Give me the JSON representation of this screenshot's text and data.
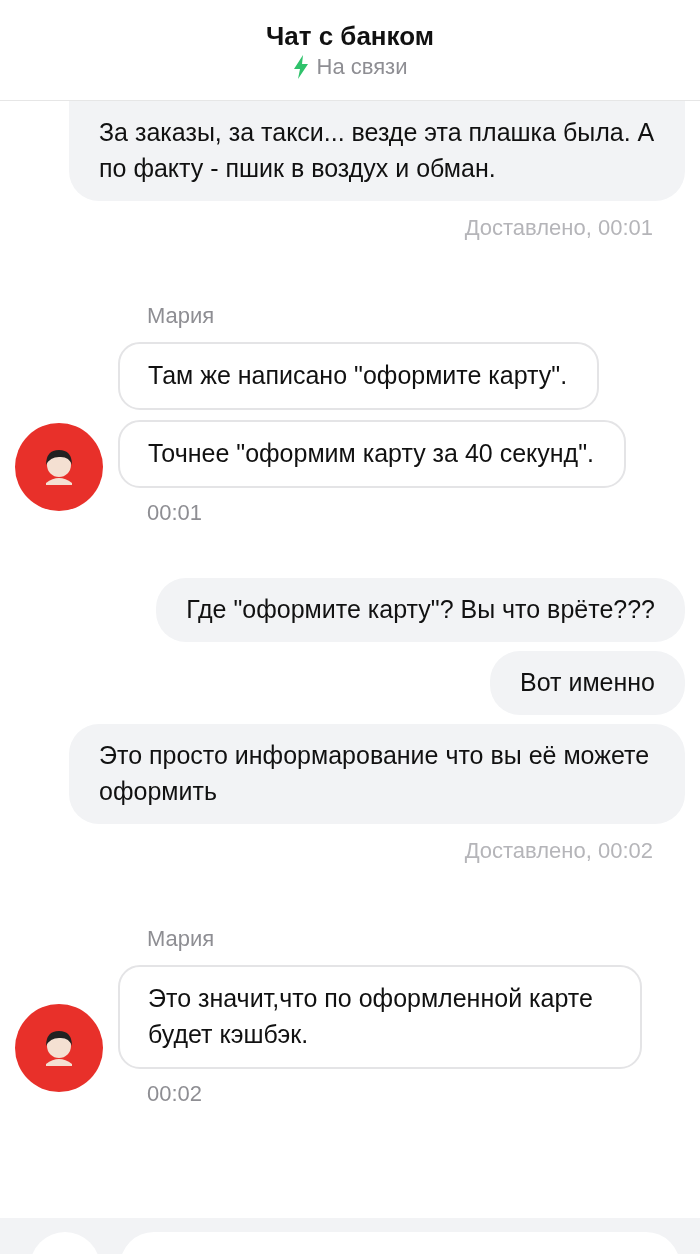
{
  "header": {
    "title": "Чат с банком",
    "status": "На связи"
  },
  "messages": [
    {
      "kind": "outgoing",
      "bubbles": [
        "За заказы, за такси... везде эта плашка была. А по факту - пшик в воздух и обман."
      ],
      "footer": "Доставлено, 00:01"
    },
    {
      "kind": "incoming",
      "sender": "Мария",
      "bubbles": [
        "Там же написано \"оформите карту\".",
        "Точнее \"оформим карту за 40 секунд\"."
      ],
      "footer": "00:01"
    },
    {
      "kind": "outgoing",
      "bubbles": [
        "Где \"оформите карту\"? Вы что врёте???",
        "Вот именно",
        "Это просто информарование что вы её можете оформить"
      ],
      "footer": "Доставлено, 00:02"
    },
    {
      "kind": "incoming",
      "sender": "Мария",
      "bubbles": [
        "Это значит,что по оформленной карте будет кэшбэк."
      ],
      "footer": "00:02"
    }
  ]
}
